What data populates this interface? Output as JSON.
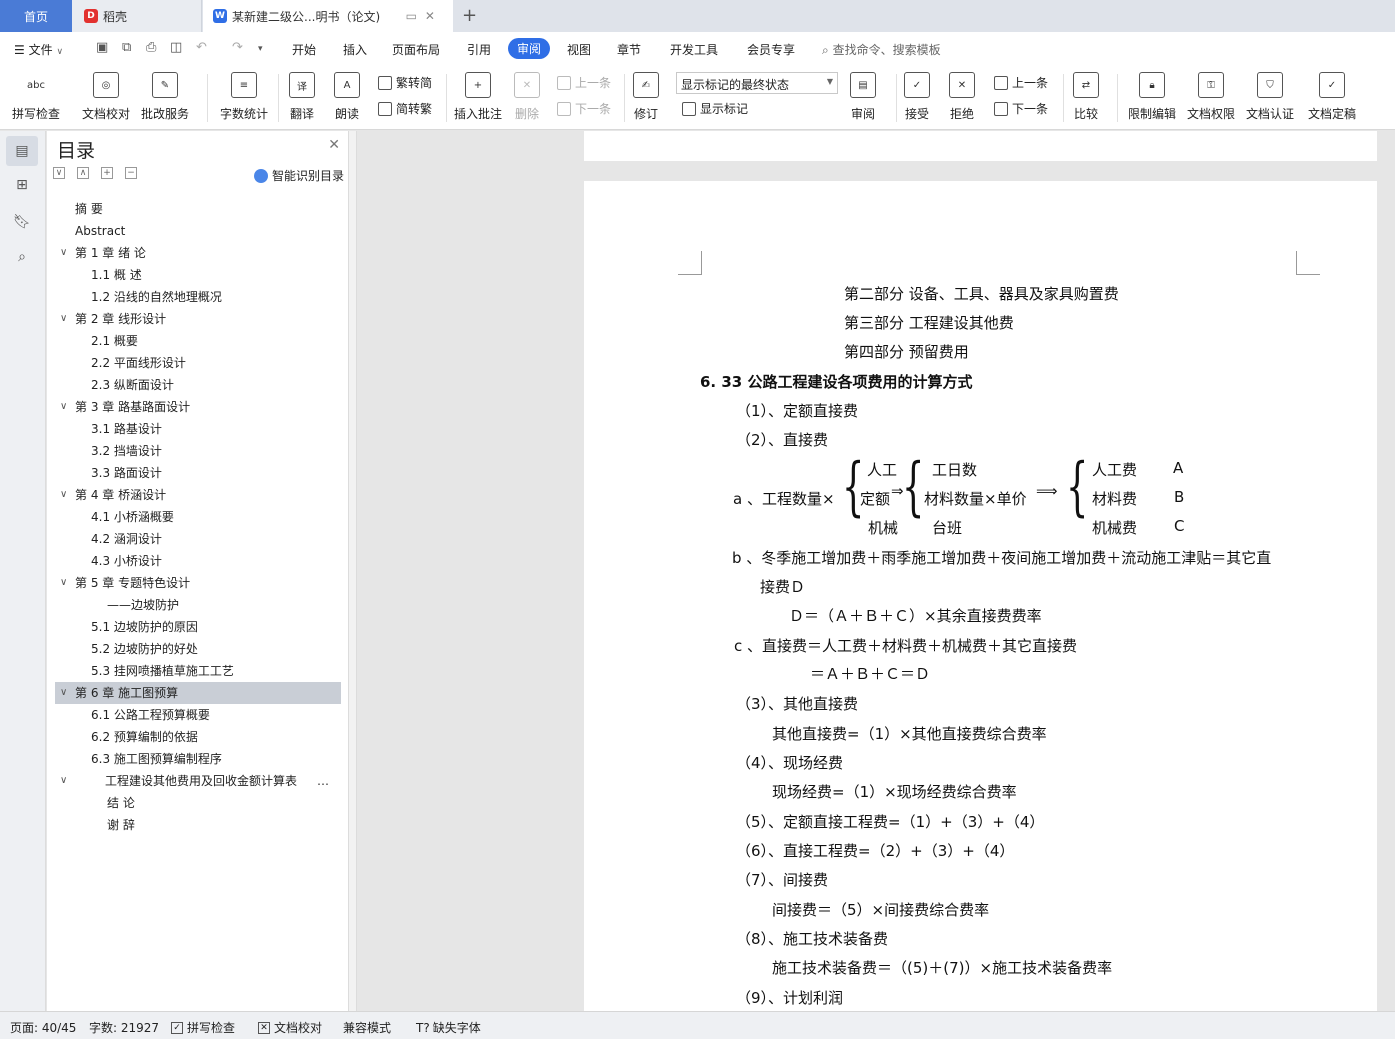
{
  "tabs": {
    "home": "首页",
    "daoke": "稻壳",
    "doc": "某新建二级公...明书（论文)"
  },
  "menu": {
    "file": "文件",
    "items": [
      "开始",
      "插入",
      "页面布局",
      "引用",
      "审阅",
      "视图",
      "章节",
      "开发工具",
      "会员专享"
    ],
    "active": "审阅",
    "search": "查找命令、搜索模板"
  },
  "ribbon": {
    "spell_check": "拼写检查",
    "doc_proof": "文档校对",
    "batch_service": "批改服务",
    "word_count": "字数统计",
    "translate": "翻译",
    "read_aloud": "朗读",
    "simp_to_trad": "繁转简",
    "trad_to_simp": "简转繁",
    "insert_comment": "插入批注",
    "delete": "删除",
    "prev_comment": "上一条",
    "next_comment": "下一条",
    "revise": "修订",
    "markup_state": "显示标记的最终状态",
    "show_markup": "显示标记",
    "review": "审阅",
    "accept": "接受",
    "reject": "拒绝",
    "prev_change": "上一条",
    "next_change": "下一条",
    "compare": "比较",
    "restrict_edit": "限制编辑",
    "doc_permission": "文档权限",
    "doc_cert": "文档认证",
    "doc_finalize": "文档定稿",
    "abc": "abc"
  },
  "toc": {
    "title": "目录",
    "smart": "智能识别目录",
    "items": [
      {
        "text": "摘  要",
        "level": 1,
        "arrow": ""
      },
      {
        "text": "Abstract",
        "level": 1,
        "arrow": ""
      },
      {
        "text": "第 1 章  绪  论",
        "level": 1,
        "arrow": "∨"
      },
      {
        "text": "1.1    概    述",
        "level": 2,
        "arrow": ""
      },
      {
        "text": "1.2    沿线的自然地理概况",
        "level": 2,
        "arrow": ""
      },
      {
        "text": "第 2 章  线形设计",
        "level": 1,
        "arrow": "∨"
      },
      {
        "text": "2.1 概要",
        "level": 2,
        "arrow": ""
      },
      {
        "text": "2.2 平面线形设计",
        "level": 2,
        "arrow": ""
      },
      {
        "text": "2.3  纵断面设计",
        "level": 2,
        "arrow": ""
      },
      {
        "text": "第 3 章  路基路面设计",
        "level": 1,
        "arrow": "∨"
      },
      {
        "text": "3.1  路基设计",
        "level": 2,
        "arrow": ""
      },
      {
        "text": "3.2    挡墙设计",
        "level": 2,
        "arrow": ""
      },
      {
        "text": "3.3    路面设计",
        "level": 2,
        "arrow": ""
      },
      {
        "text": "第 4 章  桥涵设计",
        "level": 1,
        "arrow": "∨"
      },
      {
        "text": "4.1 小桥涵概要",
        "level": 2,
        "arrow": ""
      },
      {
        "text": "4.2 涵洞设计",
        "level": 2,
        "arrow": ""
      },
      {
        "text": "4.3 小桥设计",
        "level": 2,
        "arrow": ""
      },
      {
        "text": "第 5 章    专题特色设计",
        "level": 1,
        "arrow": "∨"
      },
      {
        "text": "——边坡防护",
        "level": 3,
        "arrow": ""
      },
      {
        "text": "5.1 边坡防护的原因",
        "level": 2,
        "arrow": ""
      },
      {
        "text": "5.2 边坡防护的好处",
        "level": 2,
        "arrow": ""
      },
      {
        "text": "5.3 挂网喷播植草施工工艺",
        "level": 2,
        "arrow": ""
      },
      {
        "text": "第 6 章  施工图预算",
        "level": 1,
        "arrow": "∨",
        "selected": true
      },
      {
        "text": "6.1 公路工程预算概要",
        "level": 2,
        "arrow": ""
      },
      {
        "text": "6.2 预算编制的依据",
        "level": 2,
        "arrow": ""
      },
      {
        "text": "6.3 施工图预算编制程序",
        "level": 2,
        "arrow": ""
      },
      {
        "text": "工程建设其他费用及回收金额计算表",
        "level": 4,
        "arrow": "∨",
        "more": "…"
      },
      {
        "text": "结  论",
        "level": 3,
        "arrow": ""
      },
      {
        "text": "谢  辞",
        "level": 3,
        "arrow": ""
      }
    ]
  },
  "doc": {
    "lines": [
      "第二部分  设备、工具、器具及家具购置费",
      "第三部分  工程建设其他费",
      "第四部分  预留费用",
      "6. 33 公路工程建设各项费用的计算方式",
      "（1）、定额直接费",
      "（2）、直接费",
      "a 、工程数量×",
      "人工",
      "定额",
      "机械",
      "工日数",
      "材料数量×单价",
      "台班",
      "人工费",
      "材料费",
      "机械费",
      "A",
      "B",
      "C",
      "b 、冬季施工增加费＋雨季施工增加费＋夜间施工增加费＋流动施工津贴＝其它直",
      "接费Ｄ",
      "Ｄ＝（Ａ＋Ｂ＋Ｃ）×其余直接费费率",
      "c 、直接费＝人工费＋材料费＋机械费＋其它直接费",
      "＝Ａ＋Ｂ＋Ｃ＝Ｄ",
      "（3）、其他直接费",
      "其他直接费=（1）×其他直接费综合费率",
      "（4）、现场经费",
      "现场经费=（1）×现场经费综合费率",
      "（5）、定额直接工程费=（1）+（3）+（4）",
      "（6）、直接工程费=（2）+（3）+（4）",
      "（7）、间接费",
      "间接费＝（5）×间接费综合费率",
      "（8）、施工技术装备费",
      "施工技术装备费＝（(5)＋(7)）×施工技术装备费率",
      "（9）、计划利润"
    ],
    "arrow1": "⇒",
    "arrow2": "⟹"
  },
  "status": {
    "page": "页面: 40/45",
    "words": "字数: 21927",
    "spell": "拼写检查",
    "proof": "文档校对",
    "compat": "兼容模式",
    "missing_font": "缺失字体"
  }
}
